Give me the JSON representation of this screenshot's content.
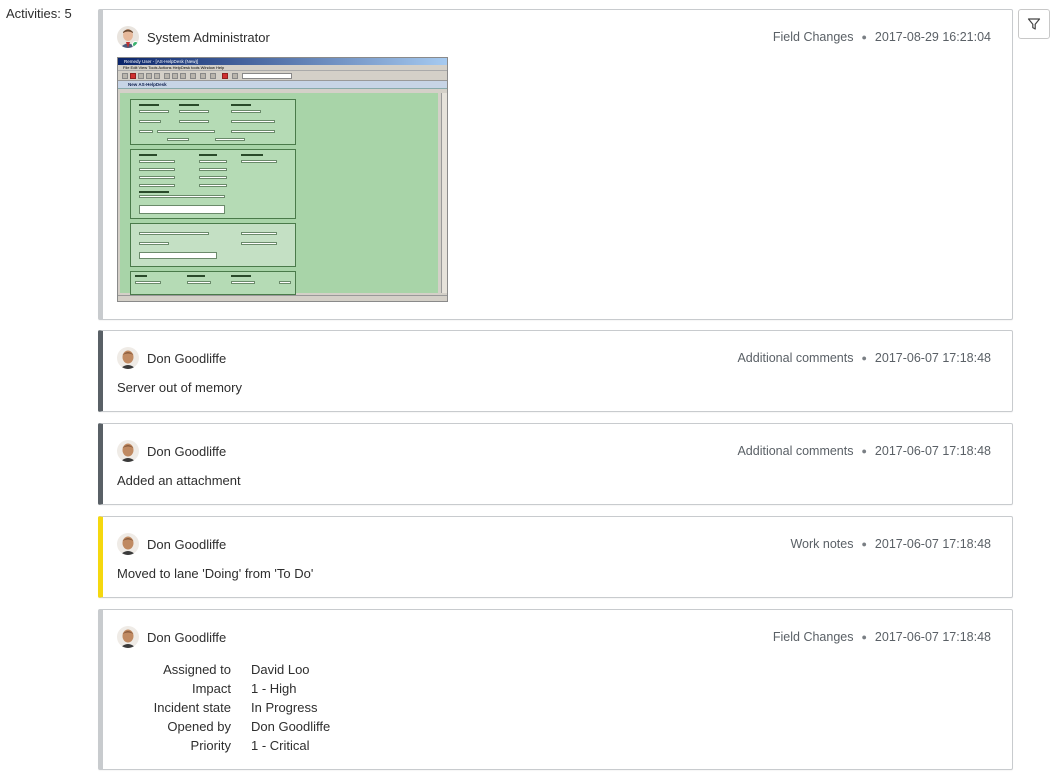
{
  "activities_label": "Activities: 5",
  "filter": {
    "icon": "filter-icon"
  },
  "screenshot_window": {
    "title": "Remedy User - [AS-HelpDesk (New)]",
    "menu": "File  Edit  View  Tools  Actions  HelpDesk tools  Window  Help",
    "form_title": "New AS-HelpDesk"
  },
  "activities": [
    {
      "author": "System Administrator",
      "type": "Field Changes",
      "timestamp": "2017-08-29 16:21:04",
      "accent": "#c8cbce",
      "has_attachment_preview": true
    },
    {
      "author": "Don Goodliffe",
      "type": "Additional comments",
      "timestamp": "2017-06-07 17:18:48",
      "text": "Server out of memory",
      "accent": "#596066"
    },
    {
      "author": "Don Goodliffe",
      "type": "Additional comments",
      "timestamp": "2017-06-07 17:18:48",
      "text": "Added an attachment",
      "accent": "#596066"
    },
    {
      "author": "Don Goodliffe",
      "type": "Work notes",
      "timestamp": "2017-06-07 17:18:48",
      "text": "Moved to lane 'Doing' from 'To Do'",
      "accent": "#f5d80f"
    },
    {
      "author": "Don Goodliffe",
      "type": "Field Changes",
      "timestamp": "2017-06-07 17:18:48",
      "accent": "#c8cbce",
      "fields": [
        {
          "label": "Assigned to",
          "value": "David Loo"
        },
        {
          "label": "Impact",
          "value": "1 - High"
        },
        {
          "label": "Incident state",
          "value": "In Progress"
        },
        {
          "label": "Opened by",
          "value": "Don Goodliffe"
        },
        {
          "label": "Priority",
          "value": "1 - Critical"
        }
      ]
    }
  ]
}
